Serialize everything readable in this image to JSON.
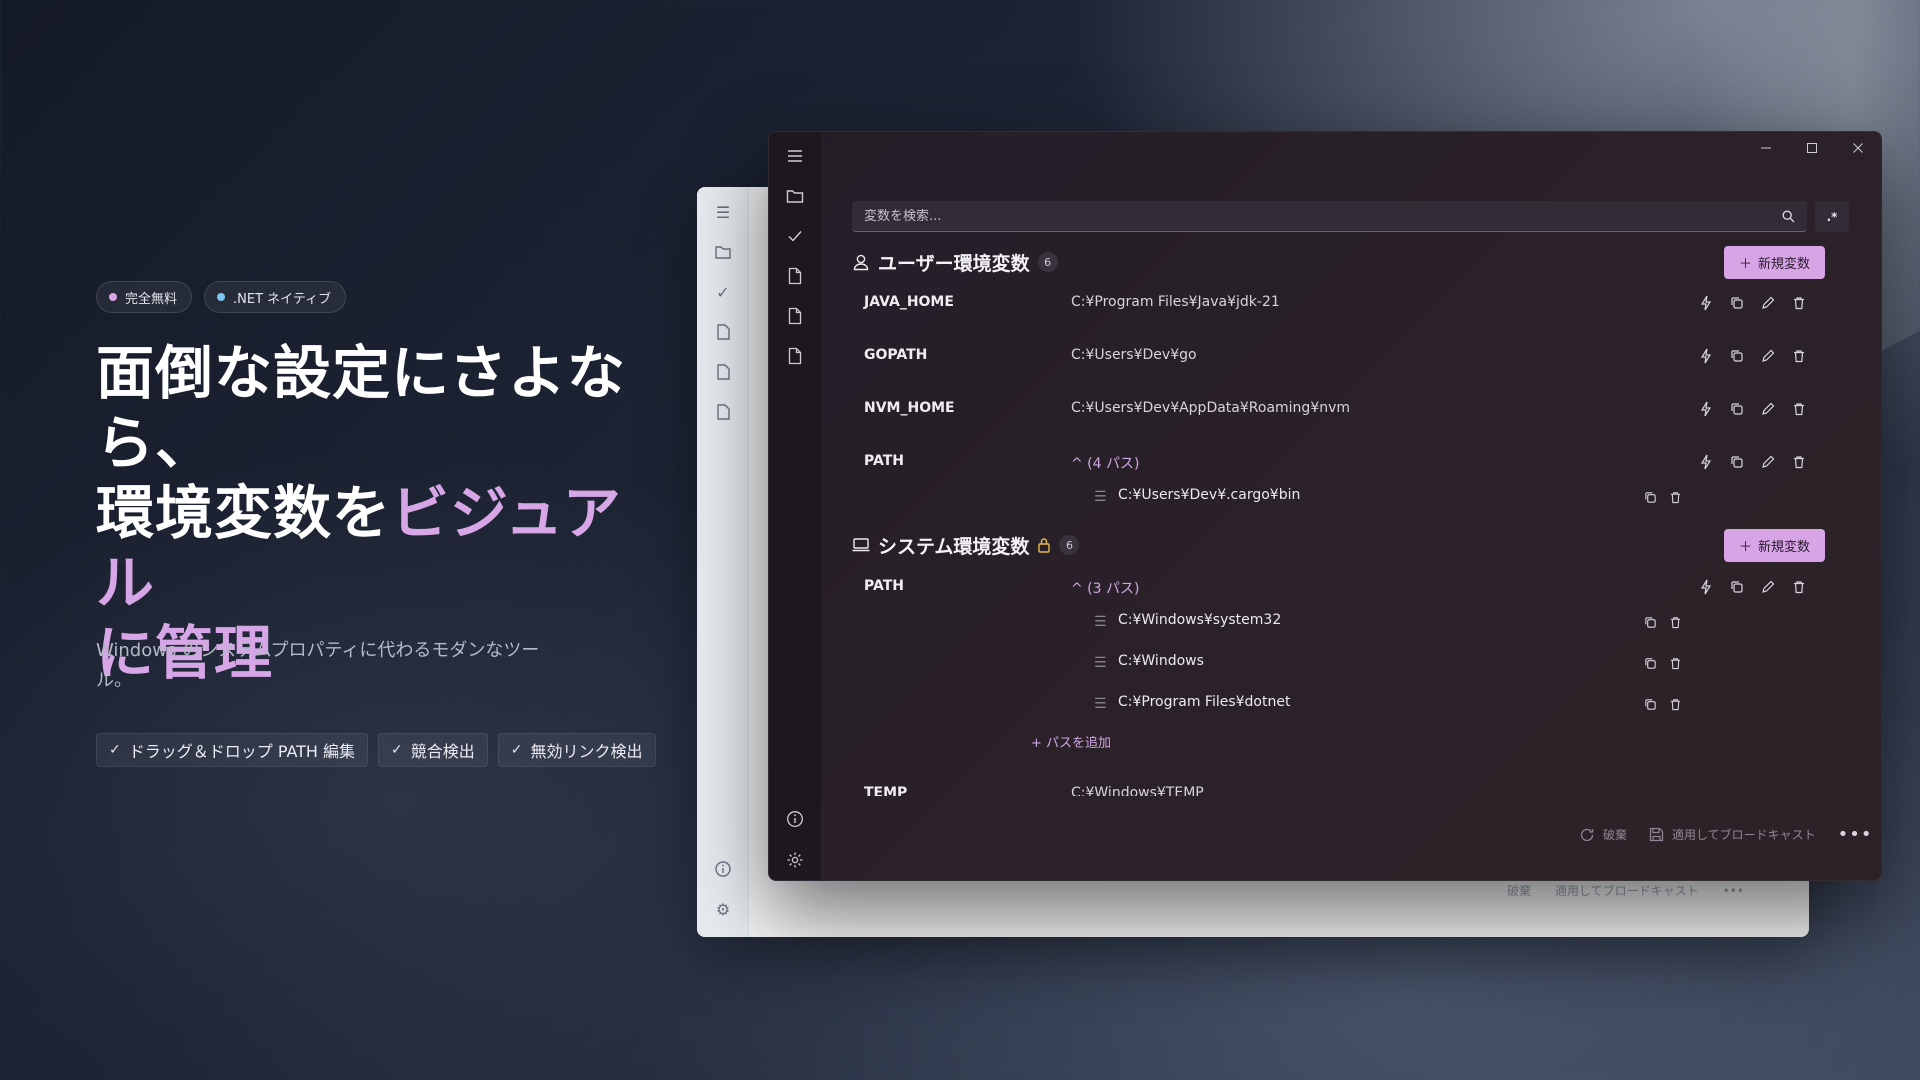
{
  "hero": {
    "badges": [
      {
        "label": "完全無料",
        "dot_color": "#d7a5e6"
      },
      {
        "label": ".NET ネイティブ",
        "dot_color": "#7cc4f2"
      }
    ],
    "title_line1": "面倒な設定にさよなら、",
    "title_line2_white": "環境変数を",
    "title_line2_accent": "ビジュアル",
    "title_line3_accent": "に管理",
    "subtitle": "Windows のシステムプロパティに代わるモダンなツール。",
    "features": [
      "ドラッグ＆ドロップ PATH 編集",
      "競合検出",
      "無効リンク検出"
    ]
  },
  "back_window": {
    "footer_discard": "破棄",
    "footer_apply": "適用してブロードキャスト"
  },
  "app": {
    "search_placeholder": "変数を検索...",
    "regex_label": ".*",
    "user_section": {
      "title": "ユーザー環境変数",
      "count": "6",
      "new_button": "新規変数",
      "variables": [
        {
          "name": "JAVA_HOME",
          "value": "C:¥Program Files¥Java¥jdk-21"
        },
        {
          "name": "GOPATH",
          "value": "C:¥Users¥Dev¥go"
        },
        {
          "name": "NVM_HOME",
          "value": "C:¥Users¥Dev¥AppData¥Roaming¥nvm"
        }
      ],
      "path": {
        "name": "PATH",
        "toggle": "^ (4 パス)",
        "entries": [
          "C:¥Users¥Dev¥.cargo¥bin"
        ]
      }
    },
    "system_section": {
      "title": "システム環境変数",
      "count": "6",
      "new_button": "新規変数",
      "path": {
        "name": "PATH",
        "toggle": "^ (3 パス)",
        "entries": [
          "C:¥Windows¥system32",
          "C:¥Windows",
          "C:¥Program Files¥dotnet"
        ],
        "add_label": "+ パスを追加"
      },
      "temp": {
        "name": "TEMP",
        "value": "C:¥Windows¥TEMP"
      }
    },
    "footer": {
      "discard": "破棄",
      "apply": "適用してブロードキャスト",
      "more": "•••"
    },
    "colors": {
      "accent": "#d7a5e6",
      "lock": "#e8b949"
    }
  }
}
